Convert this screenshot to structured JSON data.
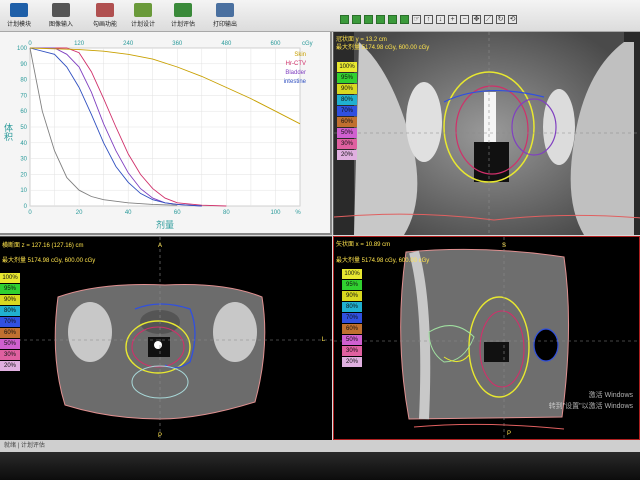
{
  "toolbar": {
    "buttons": [
      {
        "label": "计划模块",
        "color": "#1e5fa8"
      },
      {
        "label": "图像输入",
        "color": "#555555"
      },
      {
        "label": "勾画功能",
        "color": "#b05050"
      },
      {
        "label": "计划设计",
        "color": "#6a9a3a"
      },
      {
        "label": "计划评估",
        "color": "#3a8a3a"
      },
      {
        "label": "打印输出",
        "color": "#4a70a0"
      }
    ]
  },
  "dvh": {
    "top_axis_ticks": [
      "0",
      "120",
      "240",
      "360",
      "480",
      "600"
    ],
    "top_axis_unit": "cGy",
    "left_axis_ticks": [
      "100",
      "90",
      "80",
      "70",
      "60",
      "50",
      "40",
      "30",
      "20",
      "10",
      "0"
    ],
    "bottom_axis_ticks": [
      "0",
      "20",
      "40",
      "60",
      "80",
      "100"
    ],
    "bottom_axis_unit": "%",
    "xlabel": "剂量",
    "ylabel": "体积",
    "legend": [
      {
        "name": "Skin",
        "color": "#c8a000"
      },
      {
        "name": "Hr-CTV",
        "color": "#d0306a"
      },
      {
        "name": "Bladder",
        "color": "#8040c0"
      },
      {
        "name": "intestine",
        "color": "#3050c0"
      }
    ]
  },
  "chart_data": {
    "type": "line",
    "xlabel": "剂量",
    "ylabel": "体积",
    "x_unit": "%",
    "xlim": [
      0,
      110
    ],
    "ylim": [
      0,
      100
    ],
    "series": [
      {
        "name": "Hr-CTV",
        "color": "#d0306a",
        "x": [
          0,
          15,
          20,
          25,
          30,
          35,
          40,
          45,
          50,
          55,
          60,
          70,
          80
        ],
        "y": [
          100,
          100,
          97,
          85,
          68,
          50,
          33,
          20,
          11,
          5,
          2,
          0.5,
          0
        ]
      },
      {
        "name": "Bladder",
        "color": "#8040c0",
        "x": [
          0,
          10,
          15,
          20,
          25,
          30,
          35,
          40,
          45,
          50,
          55,
          60,
          70
        ],
        "y": [
          100,
          100,
          96,
          88,
          72,
          52,
          35,
          21,
          11,
          5,
          2,
          1,
          0
        ]
      },
      {
        "name": "intestine",
        "color": "#3050c0",
        "x": [
          0,
          10,
          15,
          20,
          25,
          30,
          35,
          40,
          45,
          50,
          55,
          60,
          70
        ],
        "y": [
          100,
          96,
          88,
          75,
          58,
          40,
          25,
          15,
          8,
          4,
          2,
          1,
          0
        ]
      },
      {
        "name": "Skin",
        "color": "#c8a000",
        "x": [
          0,
          10,
          20,
          30,
          40,
          50,
          60,
          70,
          80,
          90,
          100,
          110
        ],
        "y": [
          100,
          99.5,
          99,
          98,
          96,
          93,
          88,
          82,
          75,
          68,
          60,
          52
        ]
      },
      {
        "name": "",
        "color": "#808080",
        "x": [
          0,
          5,
          10,
          15,
          20,
          25,
          30,
          40,
          50,
          60
        ],
        "y": [
          100,
          60,
          35,
          18,
          10,
          6,
          4,
          2,
          1,
          0.5
        ]
      }
    ]
  },
  "coronal": {
    "header": "冠状面 y = 13.2 cm",
    "maxdose": "最大剂量 5174.98 cGy, 600.00 cGy"
  },
  "axial": {
    "header": "横断面 z = 127.16 (127.16) cm",
    "maxdose": "最大剂量 5174.98 cGy, 600.00 cGy",
    "orient_top": "A",
    "orient_bottom": "P",
    "orient_right": "L"
  },
  "sagittal": {
    "header": "矢状面 x = 10.89 cm",
    "maxdose": "最大剂量 5174.98 cGy, 600.00 cGy",
    "orient_top": "S",
    "orient_bottom": "P"
  },
  "isodose": [
    {
      "label": "100%",
      "color": "#e8e830"
    },
    {
      "label": "95%",
      "color": "#30d030"
    },
    {
      "label": "90%",
      "color": "#d8d820"
    },
    {
      "label": "80%",
      "color": "#20b0d0"
    },
    {
      "label": "70%",
      "color": "#3050e0"
    },
    {
      "label": "60%",
      "color": "#c07030"
    },
    {
      "label": "50%",
      "color": "#d060d0"
    },
    {
      "label": "30%",
      "color": "#e060a0"
    },
    {
      "label": "20%",
      "color": "#e0b0e0"
    }
  ],
  "watermark": {
    "line1": "激活 Windows",
    "line2": "转到\"设置\"以激活 Windows"
  },
  "status": {
    "text": "就绪 | 计划评估"
  }
}
